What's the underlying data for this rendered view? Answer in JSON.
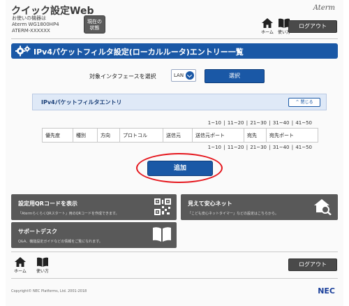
{
  "header": {
    "app_title": "クイック設定Web",
    "device_label": "お使いの機器は",
    "device_model": "Aterm WG1800HP4",
    "device_id": "ATERM-XXXXXX",
    "status_button_line1": "現在の",
    "status_button_line2": "状態",
    "brand": "Aterm",
    "home_label": "ホーム",
    "help_label": "使い方",
    "logout_label": "ログアウト"
  },
  "page_title": "IPv4パケットフィルタ設定(ローカルルータ)エントリー一覧",
  "interface": {
    "label": "対象インタフェースを選択",
    "selected": "LAN",
    "select_button": "選択"
  },
  "entry_section": {
    "title": "IPv4パケットフィルタエントリ",
    "collapse_label": "閉じる",
    "pager": [
      "1~10",
      "11~20",
      "21~30",
      "31~40",
      "41~50"
    ],
    "columns": [
      "優先度",
      "種別",
      "方向",
      "プロトコル",
      "送信元",
      "送信元ポート",
      "宛先",
      "宛先ポート"
    ],
    "add_button": "追加"
  },
  "tiles": [
    {
      "title": "設定用QRコードを表示",
      "desc": "「AtermらくらくQRスタート」用のQRコードを作成できます。"
    },
    {
      "title": "見えて安心ネット",
      "desc": "「こども安心ネットタイマー」などの設定はこちらから。"
    },
    {
      "title": "サポートデスク",
      "desc": "Q&A、機能設定ガイドなどの情報をご覧になれます。"
    }
  ],
  "footer": {
    "home_label": "ホーム",
    "help_label": "使い方",
    "logout_label": "ログアウト",
    "copyright": "Copyright© NEC Platforms, Ltd. 2001-2018",
    "nec": "NEC"
  },
  "colors": {
    "accent": "#1a58a6",
    "tile": "#595959",
    "highlight_circle": "#e5161d"
  }
}
